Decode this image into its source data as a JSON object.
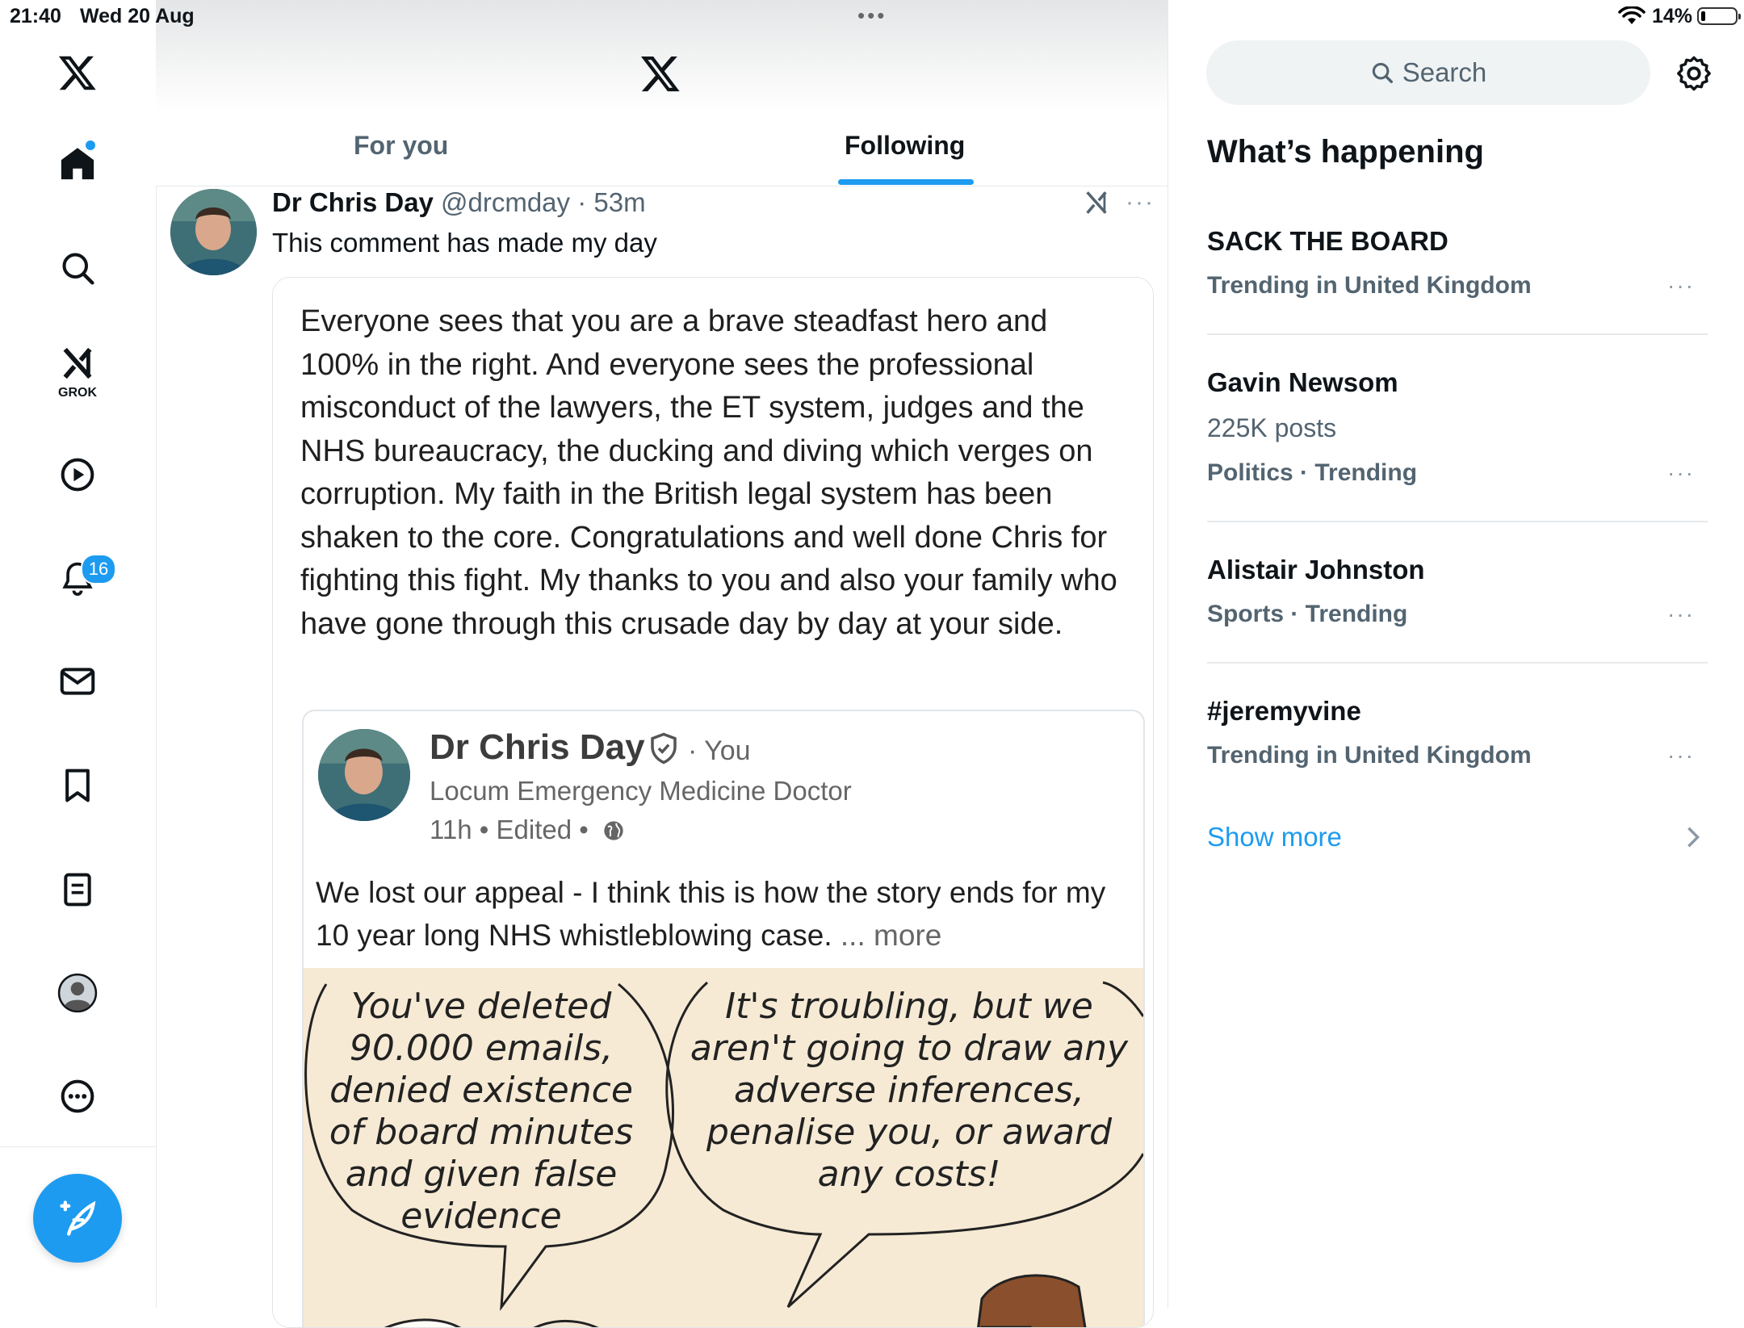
{
  "status_bar": {
    "time": "21:40",
    "date": "Wed 20 Aug",
    "battery": "14%"
  },
  "sidebar": {
    "items": [
      {
        "icon": "x-logo-icon"
      },
      {
        "icon": "home-icon"
      },
      {
        "icon": "search-icon"
      },
      {
        "icon": "grok-icon",
        "label": "GROK"
      },
      {
        "icon": "video-play-icon"
      },
      {
        "icon": "notifications-bell-icon",
        "badge": "16"
      },
      {
        "icon": "messages-envelope-icon"
      },
      {
        "icon": "bookmark-icon"
      },
      {
        "icon": "lists-icon"
      },
      {
        "icon": "profile-avatar-icon"
      },
      {
        "icon": "more-circle-icon"
      }
    ],
    "compose_icon": "compose-feather-icon"
  },
  "timeline": {
    "tabs": [
      {
        "label": "For you",
        "active": false
      },
      {
        "label": "Following",
        "active": true
      }
    ],
    "tweet": {
      "name": "Dr Chris Day",
      "handle_time": "@drcmday · 53m",
      "text": "This comment has made my day",
      "card": {
        "comment": "Everyone sees that you are a brave steadfast hero and 100% in the right. And everyone sees the professional misconduct of the lawyers, the ET system, judges and the NHS bureaucracy, the ducking and diving which verges on corruption. My faith in the British legal system has been shaken to the core. Congratulations and well done Chris for fighting this fight. My thanks to you and also your family who have gone through this crusade day by day at your side.",
        "inner_post": {
          "name": "Dr Chris Day",
          "you_label": "· You",
          "subtitle": "Locum Emergency Medicine Doctor",
          "time": "11h • Edited •",
          "text": "We lost our appeal - I think this is how the story ends for my 10 year long NHS whistleblowing case.",
          "more": "... more",
          "cartoon": {
            "left_bubble": "You've deleted 90.000 emails, denied existence of board minutes and given false evidence",
            "right_bubble": "It's troubling, but we aren't going to draw any adverse inferences, penalise you, or award any costs!"
          }
        }
      }
    }
  },
  "right_panel": {
    "search_placeholder": "Search",
    "section_title": "What’s happening",
    "trends": [
      {
        "title": "SACK THE BOARD",
        "meta": "Trending in United Kingdom",
        "posts": ""
      },
      {
        "title": "Gavin Newsom",
        "posts": "225K posts",
        "meta": "Politics · Trending"
      },
      {
        "title": "Alistair Johnston",
        "meta": "Sports · Trending",
        "posts": ""
      },
      {
        "title": "#jeremyvine",
        "meta": "Trending in United Kingdom",
        "posts": ""
      }
    ],
    "show_more": "Show more"
  },
  "colors": {
    "accent": "#1d9bf0",
    "text_primary": "#0f1419",
    "text_secondary": "#536471"
  }
}
